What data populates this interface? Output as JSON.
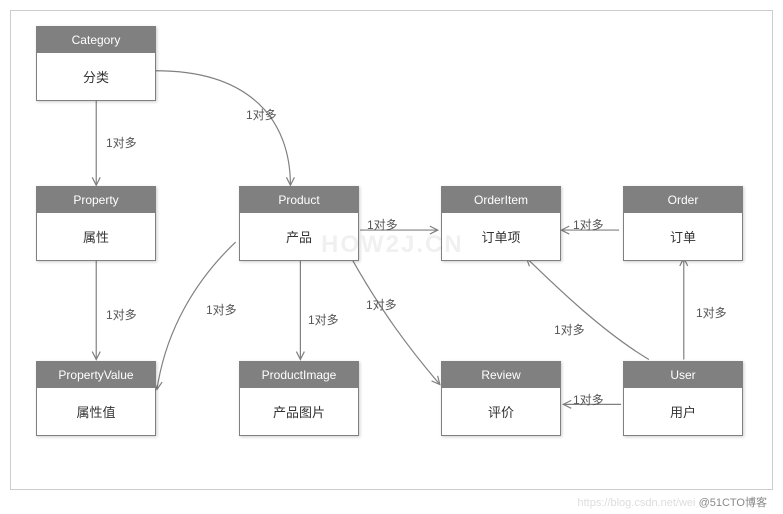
{
  "entities": {
    "category": {
      "title": "Category",
      "label": "分类"
    },
    "property": {
      "title": "Property",
      "label": "属性"
    },
    "propertyvalue": {
      "title": "PropertyValue",
      "label": "属性值"
    },
    "product": {
      "title": "Product",
      "label": "产品"
    },
    "productimage": {
      "title": "ProductImage",
      "label": "产品图片"
    },
    "orderitem": {
      "title": "OrderItem",
      "label": "订单项"
    },
    "review": {
      "title": "Review",
      "label": "评价"
    },
    "order": {
      "title": "Order",
      "label": "订单"
    },
    "user": {
      "title": "User",
      "label": "用户"
    }
  },
  "edges": {
    "category_property": {
      "label": "1对多"
    },
    "category_product": {
      "label": "1对多"
    },
    "property_propertyvalue": {
      "label": "1对多"
    },
    "product_propertyvalue": {
      "label": "1对多"
    },
    "product_productimage": {
      "label": "1对多"
    },
    "product_review": {
      "label": "1对多"
    },
    "product_orderitem": {
      "label": "1对多"
    },
    "order_orderitem": {
      "label": "1对多"
    },
    "user_order": {
      "label": "1对多"
    },
    "user_orderitem": {
      "label": "1对多"
    },
    "user_review": {
      "label": "1对多"
    }
  },
  "chart_data": {
    "type": "table",
    "title": "Entity Relationship Diagram",
    "nodes": [
      {
        "id": "Category",
        "label_en": "Category",
        "label_zh": "分类"
      },
      {
        "id": "Property",
        "label_en": "Property",
        "label_zh": "属性"
      },
      {
        "id": "PropertyValue",
        "label_en": "PropertyValue",
        "label_zh": "属性值"
      },
      {
        "id": "Product",
        "label_en": "Product",
        "label_zh": "产品"
      },
      {
        "id": "ProductImage",
        "label_en": "ProductImage",
        "label_zh": "产品图片"
      },
      {
        "id": "OrderItem",
        "label_en": "OrderItem",
        "label_zh": "订单项"
      },
      {
        "id": "Review",
        "label_en": "Review",
        "label_zh": "评价"
      },
      {
        "id": "Order",
        "label_en": "Order",
        "label_zh": "订单"
      },
      {
        "id": "User",
        "label_en": "User",
        "label_zh": "用户"
      }
    ],
    "relationships": [
      {
        "from": "Category",
        "to": "Property",
        "cardinality": "1对多"
      },
      {
        "from": "Category",
        "to": "Product",
        "cardinality": "1对多"
      },
      {
        "from": "Property",
        "to": "PropertyValue",
        "cardinality": "1对多"
      },
      {
        "from": "Product",
        "to": "PropertyValue",
        "cardinality": "1对多"
      },
      {
        "from": "Product",
        "to": "ProductImage",
        "cardinality": "1对多"
      },
      {
        "from": "Product",
        "to": "Review",
        "cardinality": "1对多"
      },
      {
        "from": "Product",
        "to": "OrderItem",
        "cardinality": "1对多"
      },
      {
        "from": "Order",
        "to": "OrderItem",
        "cardinality": "1对多"
      },
      {
        "from": "User",
        "to": "Order",
        "cardinality": "1对多"
      },
      {
        "from": "User",
        "to": "OrderItem",
        "cardinality": "1对多"
      },
      {
        "from": "User",
        "to": "Review",
        "cardinality": "1对多"
      }
    ]
  },
  "watermark": "HOW2J.CN",
  "footer": {
    "host": "https://blog.csdn.net/wei",
    "brand": "@51CTO博客"
  }
}
